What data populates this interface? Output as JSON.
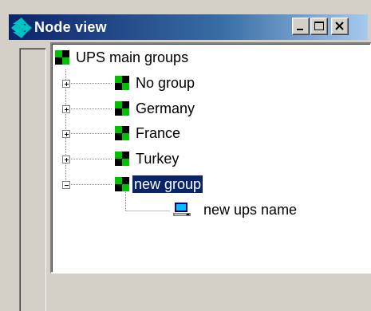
{
  "window": {
    "title": "Node view",
    "buttons": [
      "minimize-button",
      "maximize-button",
      "close-button"
    ]
  },
  "tree": {
    "root": {
      "label": "UPS main groups",
      "icon": "group-icon"
    },
    "groups": [
      {
        "label": "No group",
        "expanded": false,
        "selected": false
      },
      {
        "label": "Germany",
        "expanded": false,
        "selected": false
      },
      {
        "label": "France",
        "expanded": false,
        "selected": false
      },
      {
        "label": "Turkey",
        "expanded": false,
        "selected": false
      },
      {
        "label": "new group",
        "expanded": true,
        "selected": true
      }
    ],
    "children": [
      {
        "label": "new ups name",
        "icon": "computer-icon"
      }
    ]
  },
  "colors": {
    "selection": "#0a246a",
    "titlebar_start": "#0a246a",
    "titlebar_end": "#a6caf0",
    "group_green": "#00c000",
    "group_black": "#000000"
  }
}
